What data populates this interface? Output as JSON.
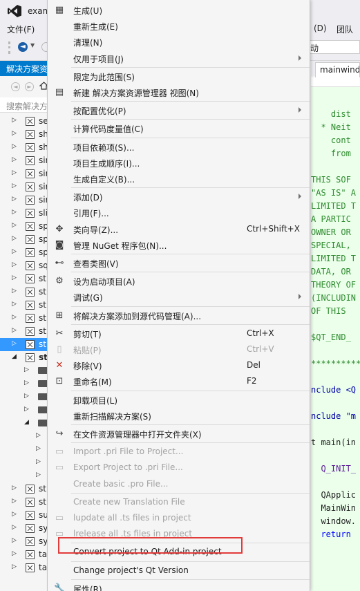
{
  "window": {
    "title": "exam"
  },
  "menubar": {
    "file": "文件(F)",
    "debug_partial": "(D)",
    "team_partial": "团队(N"
  },
  "toolbar": {
    "start_partial": "动"
  },
  "solution_explorer": {
    "header": "解决方案资",
    "search_placeholder": "搜索解决方",
    "items": [
      "se",
      "sh",
      "sh",
      "sir",
      "sir",
      "sir",
      "sir",
      "sli",
      "sp",
      "sp",
      "sp",
      "sq",
      "st",
      "st",
      "st",
      "st",
      "st",
      "st",
      "st",
      "st",
      "st",
      "su",
      "sy",
      "sy",
      "ta",
      "ta"
    ]
  },
  "editor": {
    "tab": "mainwindo",
    "lines": [
      "    dist",
      "  * Neit",
      "    cont",
      "    from",
      "",
      "THIS SOF",
      "\"AS IS\" A",
      "LIMITED T",
      "A PARTIC",
      "OWNER OR",
      "SPECIAL,",
      "LIMITED T",
      "DATA, OR",
      "THEORY OF",
      "(INCLUDIN",
      "OF THIS",
      "",
      "$QT_END_",
      "",
      "**********",
      "",
      "nclude <Q",
      "",
      "nclude \"m",
      "",
      "t main(in",
      "",
      "  Q_INIT_",
      "",
      "  QApplic",
      "  MainWin",
      "  window.",
      "  return"
    ]
  },
  "context_menu": {
    "items": [
      {
        "label": "生成(U)",
        "icon": "build-icon"
      },
      {
        "label": "重新生成(E)"
      },
      {
        "label": "清理(N)"
      },
      {
        "label": "仅用于项目(J)",
        "submenu": true
      },
      {
        "sep": true
      },
      {
        "label": "限定为此范围(S)"
      },
      {
        "label": "新建 解决方案资源管理器 视图(N)",
        "icon": "new-view-icon"
      },
      {
        "sep": true
      },
      {
        "label": "按配置优化(P)",
        "submenu": true
      },
      {
        "sep": true
      },
      {
        "label": "计算代码度量值(C)"
      },
      {
        "sep": true
      },
      {
        "label": "项目依赖项(S)..."
      },
      {
        "label": "项目生成顺序(I)..."
      },
      {
        "label": "生成自定义(B)..."
      },
      {
        "sep": true
      },
      {
        "label": "添加(D)",
        "submenu": true
      },
      {
        "label": "引用(F)..."
      },
      {
        "label": "类向导(Z)...",
        "icon": "class-wizard-icon",
        "shortcut": "Ctrl+Shift+X"
      },
      {
        "label": "管理 NuGet 程序包(N)...",
        "icon": "nuget-icon"
      },
      {
        "sep": true
      },
      {
        "label": "查看类图(V)",
        "icon": "class-diagram-icon"
      },
      {
        "sep": true
      },
      {
        "label": "设为启动项目(A)",
        "icon": "gear-icon"
      },
      {
        "label": "调试(G)",
        "submenu": true
      },
      {
        "sep": true
      },
      {
        "label": "将解决方案添加到源代码管理(A)...",
        "icon": "source-control-icon"
      },
      {
        "sep": true
      },
      {
        "label": "剪切(T)",
        "icon": "scissors-icon",
        "shortcut": "Ctrl+X"
      },
      {
        "label": "粘贴(P)",
        "icon": "paste-icon",
        "shortcut": "Ctrl+V",
        "disabled": true
      },
      {
        "label": "移除(V)",
        "icon": "remove-icon",
        "shortcut": "Del"
      },
      {
        "label": "重命名(M)",
        "icon": "rename-icon",
        "shortcut": "F2"
      },
      {
        "sep": true
      },
      {
        "label": "卸载项目(L)"
      },
      {
        "label": "重新扫描解决方案(S)"
      },
      {
        "sep": true
      },
      {
        "label": "在文件资源管理器中打开文件夹(X)",
        "icon": "open-folder-icon"
      },
      {
        "sep": true
      },
      {
        "label": "Import .pri File to Project...",
        "icon": "qt-icon",
        "disabled": true
      },
      {
        "label": "Export Project to .pri File...",
        "icon": "qt-icon",
        "disabled": true
      },
      {
        "label": "Create basic .pro File...",
        "disabled": true
      },
      {
        "sep": true
      },
      {
        "label": "Create new Translation File",
        "disabled": true
      },
      {
        "label": "lupdate all .ts files in project",
        "icon": "qt-icon",
        "disabled": true
      },
      {
        "label": "lrelease all .ts files in project",
        "icon": "qt-icon",
        "disabled": true
      },
      {
        "sep": true
      },
      {
        "label": "Convert project to Qt Add-in project"
      },
      {
        "sep": true
      },
      {
        "label": "Change project's Qt Version"
      },
      {
        "sep": true
      },
      {
        "label": "属性(R)",
        "icon": "wrench-icon"
      }
    ]
  },
  "colors": {
    "accent": "#007acc",
    "highlight_box": "#e23b3b",
    "selection": "#3399ff"
  }
}
